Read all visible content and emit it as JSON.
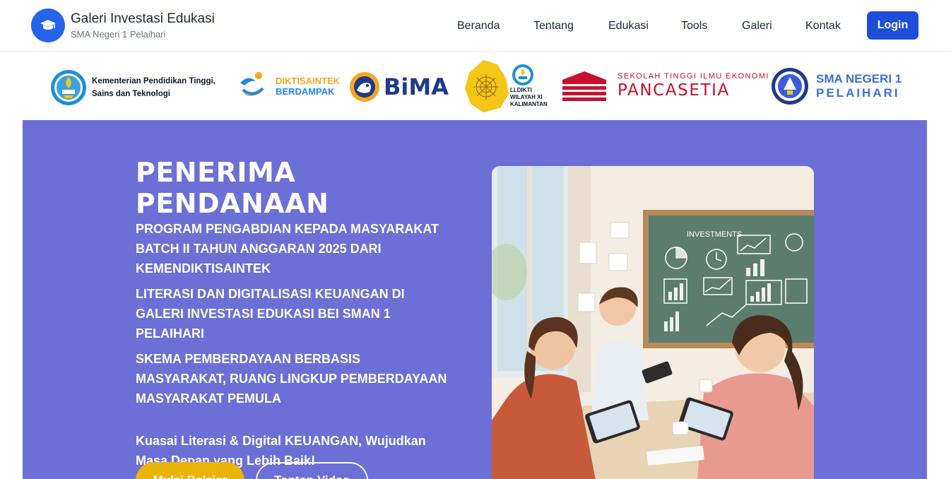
{
  "brand": {
    "title": "Galeri Investasi Edukasi",
    "subtitle": "SMA Negeri 1 Pelaihari",
    "icon": "graduation-cap-icon"
  },
  "nav": {
    "items": [
      {
        "label": "Beranda"
      },
      {
        "label": "Tentang"
      },
      {
        "label": "Edukasi"
      },
      {
        "label": "Tools"
      },
      {
        "label": "Galeri"
      },
      {
        "label": "Kontak"
      }
    ],
    "login_label": "Login"
  },
  "partners": {
    "kemdikti": "Kementerian Pendidikan Tinggi, Sains dan Teknologi",
    "diktisaintek_line1": "DIKTISAINTEK",
    "diktisaintek_line2": "BERDAMPAK",
    "bima": "BiMA",
    "lldikti": "LLDIKTI WILAYAH XI KALIMANTAN",
    "stie_line1": "SEKOLAH TINGGI ILMU EKONOMI",
    "stie_line2": "PANCASETIA",
    "sman_line1": "SMA NEGERI 1",
    "sman_line2": "PELAIHARI"
  },
  "hero": {
    "title_line1": "PENERIMA",
    "title_line2": "PENDANAAN",
    "para1": "PROGRAM PENGABDIAN KEPADA MASYARAKAT BATCH II TAHUN ANGGARAN 2025 DARI KEMENDIKTISAINTEK",
    "para2": "LITERASI DAN DIGITALISASI KEUANGAN DI GALERI INVESTASI EDUKASI BEI SMAN 1 PELAIHARI",
    "para3": "SKEMA PEMBERDAYAAN BERBASIS MASYARAKAT, RUANG LINGKUP PEMBERDAYAAN MASYARAKAT PEMULA",
    "tagline": "Kuasai Literasi & Digital KEUANGAN, Wujudkan Masa Depan yang Lebih Baik!",
    "primary_button": "Mulai Belajar",
    "secondary_button": "Tonton Video",
    "image_chalkboard_text": "INVESTMENTS"
  },
  "colors": {
    "primary_blue": "#1d4ed8",
    "hero_bg": "#6b6fd6",
    "accent_yellow": "#eab308"
  }
}
